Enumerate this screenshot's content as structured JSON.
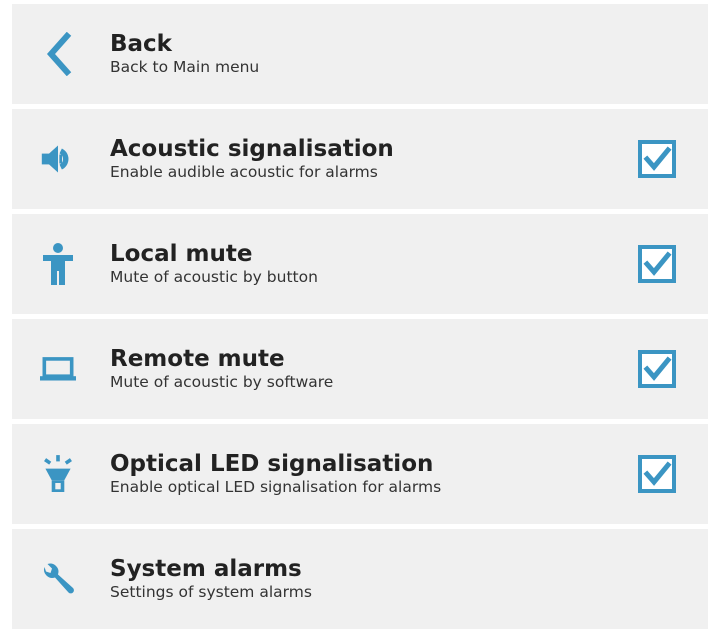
{
  "menu": {
    "items": [
      {
        "title": "Back",
        "subtitle": "Back to Main menu",
        "icon": "chevron-left-icon",
        "has_checkbox": false
      },
      {
        "title": "Acoustic signalisation",
        "subtitle": "Enable audible acoustic for alarms",
        "icon": "speaker-icon",
        "has_checkbox": true,
        "checked": true
      },
      {
        "title": "Local mute",
        "subtitle": "Mute of acoustic by button",
        "icon": "person-icon",
        "has_checkbox": true,
        "checked": true
      },
      {
        "title": "Remote mute",
        "subtitle": "Mute of acoustic by software",
        "icon": "laptop-icon",
        "has_checkbox": true,
        "checked": true
      },
      {
        "title": "Optical LED signalisation",
        "subtitle": "Enable optical LED signalisation for alarms",
        "icon": "light-beacon-icon",
        "has_checkbox": true,
        "checked": true
      },
      {
        "title": "System alarms",
        "subtitle": "Settings of system alarms",
        "icon": "wrench-icon",
        "has_checkbox": false
      }
    ]
  },
  "colors": {
    "accent": "#3b95c3",
    "item_background": "#f0f0f0",
    "title_text": "#222222",
    "subtitle_text": "#333333"
  }
}
